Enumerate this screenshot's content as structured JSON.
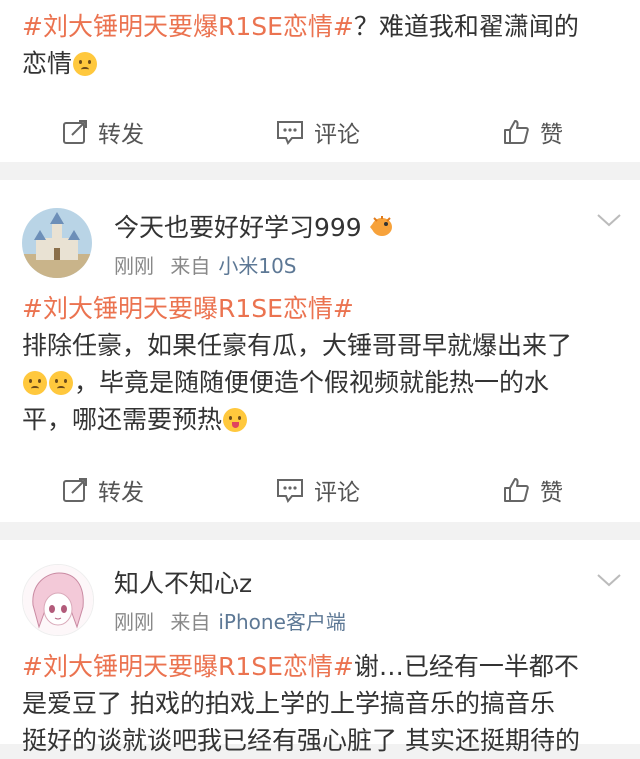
{
  "post1": {
    "hashtag": "#刘大锤明天要爆R1SE恋情#",
    "line1_rest": "？难道我和翟潇闻的",
    "line2": "恋情",
    "actions": {
      "repost": "转发",
      "comment": "评论",
      "like": "赞"
    }
  },
  "post2": {
    "username": "今天也要好好学习999",
    "time": "刚刚",
    "from_label": "来自",
    "source": "小米10S",
    "hashtag": "#刘大锤明天要曝R1SE恋情#",
    "line1": "排除任豪，如果任豪有瓜，大锤哥哥早就爆出来了",
    "line2_rest": "，毕竟是随随便便造个假视频就能热一的水",
    "line3": "平，哪还需要预热",
    "actions": {
      "repost": "转发",
      "comment": "评论",
      "like": "赞"
    }
  },
  "post3": {
    "username": "知人不知心z",
    "time": "刚刚",
    "from_label": "来自",
    "source": "iPhone客户端",
    "hashtag": "#刘大锤明天要曝R1SE恋情#",
    "line1_rest": "谢…已经有一半都不",
    "line2": "是爱豆了 拍戏的拍戏上学的上学搞音乐的搞音乐",
    "line3": "挺好的谈就谈吧我已经有强心脏了 其实还挺期待的"
  },
  "colors": {
    "hashtag": "#eb7350",
    "source_link": "#5d7895",
    "meta": "#888888",
    "divider": "#f2f2f2"
  },
  "icons": [
    "repost-icon",
    "comment-icon",
    "like-icon",
    "chevron-down-icon",
    "pufferfish-badge-icon",
    "emoji-icon"
  ]
}
